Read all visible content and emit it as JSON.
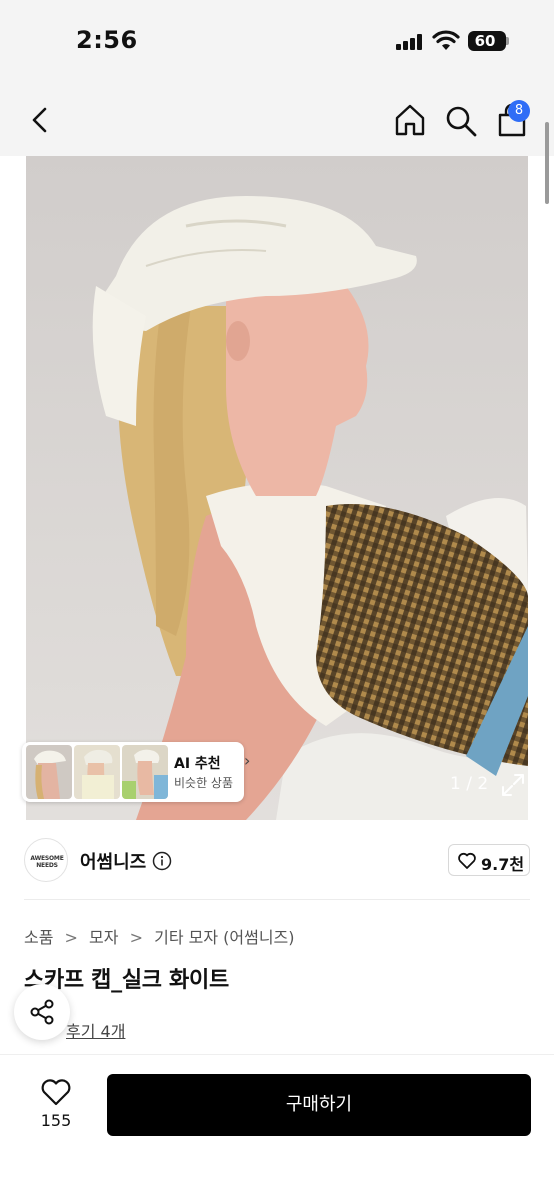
{
  "status_bar": {
    "time": "2:56",
    "battery_level": "60",
    "icons": [
      "signal-icon",
      "wifi-icon",
      "battery-icon"
    ]
  },
  "nav": {
    "icons": [
      "back-icon",
      "home-icon",
      "search-icon",
      "shopping-bag-icon"
    ],
    "cart_badge": "8"
  },
  "gallery": {
    "page_indicator": "1 / 2",
    "ai_recommend": {
      "title": "AI 추천",
      "subtitle": "비슷한 상품",
      "chevron": "›"
    }
  },
  "brand": {
    "logo_text": "AWESOME NEEDS",
    "name": "어썸니즈",
    "like_count": "9.7천"
  },
  "product": {
    "breadcrumb": [
      "소품",
      "모자",
      "기타 모자 (어썸니즈)"
    ],
    "breadcrumb_separator": ">",
    "title": "스카프 캡_실크 화이트",
    "review_link": "후기 4개"
  },
  "bottom_bar": {
    "wish_count": "155",
    "buy_label": "구매하기"
  },
  "colors": {
    "badge": "#2f6df6",
    "buy_button": "#000000",
    "page_background": "#f4f4f4"
  }
}
